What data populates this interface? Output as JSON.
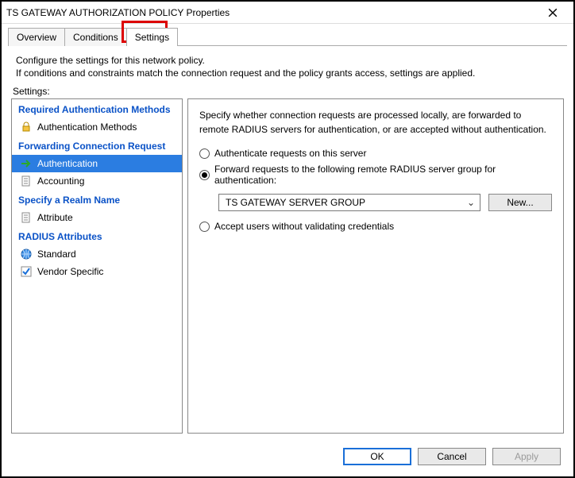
{
  "window": {
    "title": "TS GATEWAY AUTHORIZATION POLICY Properties"
  },
  "tabs": {
    "overview": "Overview",
    "conditions": "Conditions",
    "settings": "Settings"
  },
  "description": {
    "line1": "Configure the settings for this network policy.",
    "line2": "If conditions and constraints match the connection request and the policy grants access, settings are applied."
  },
  "settings_label": "Settings:",
  "sidebar": {
    "groups": [
      {
        "title": "Required Authentication Methods",
        "items": [
          {
            "label": "Authentication Methods",
            "icon": "lock"
          }
        ]
      },
      {
        "title": "Forwarding Connection Request",
        "items": [
          {
            "label": "Authentication",
            "icon": "arrow",
            "selected": true
          },
          {
            "label": "Accounting",
            "icon": "doc"
          }
        ]
      },
      {
        "title": "Specify a Realm Name",
        "items": [
          {
            "label": "Attribute",
            "icon": "doc"
          }
        ]
      },
      {
        "title": "RADIUS Attributes",
        "items": [
          {
            "label": "Standard",
            "icon": "globe"
          },
          {
            "label": "Vendor Specific",
            "icon": "check"
          }
        ]
      }
    ]
  },
  "content": {
    "intro": "Specify whether connection requests are processed locally, are forwarded to remote RADIUS servers for authentication, or are accepted without authentication.",
    "radio_local": "Authenticate requests on this server",
    "radio_forward": "Forward requests to the following remote RADIUS server group for authentication:",
    "radio_accept": "Accept users without validating credentials",
    "server_group_selected": "TS GATEWAY SERVER GROUP",
    "new_button": "New..."
  },
  "footer": {
    "ok": "OK",
    "cancel": "Cancel",
    "apply": "Apply"
  }
}
